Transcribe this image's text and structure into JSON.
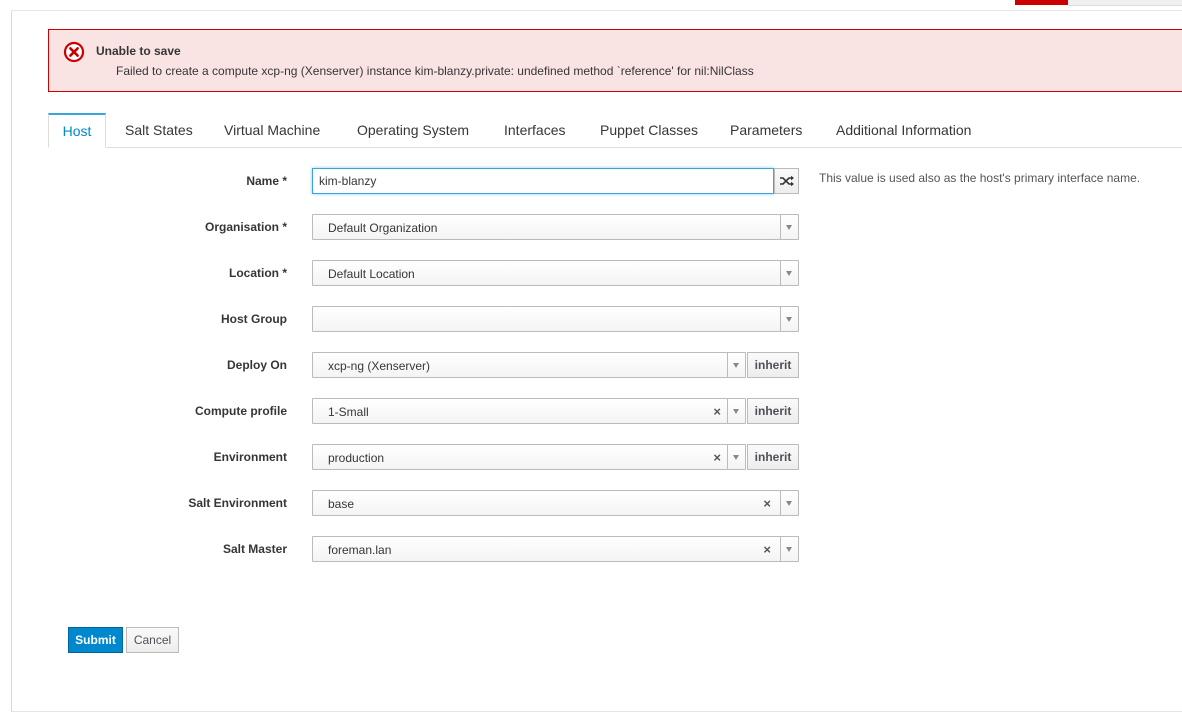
{
  "alert": {
    "title": "Unable to save",
    "message": "Failed to create a compute xcp-ng (Xenserver) instance kim-blanzy.private: undefined method `reference' for nil:NilClass"
  },
  "tabs": [
    {
      "label": "Host",
      "active": true
    },
    {
      "label": "Salt States"
    },
    {
      "label": "Virtual Machine"
    },
    {
      "label": "Operating System"
    },
    {
      "label": "Interfaces"
    },
    {
      "label": "Puppet Classes"
    },
    {
      "label": "Parameters"
    },
    {
      "label": "Additional Information"
    }
  ],
  "form": {
    "name": {
      "label": "Name *",
      "value": "kim-blanzy",
      "help": "This value is used also as the host's primary interface name."
    },
    "organisation": {
      "label": "Organisation *",
      "value": "Default Organization"
    },
    "location": {
      "label": "Location *",
      "value": "Default Location"
    },
    "host_group": {
      "label": "Host Group",
      "value": ""
    },
    "deploy_on": {
      "label": "Deploy On",
      "value": "xcp-ng (Xenserver)"
    },
    "compute_profile": {
      "label": "Compute profile",
      "value": "1-Small"
    },
    "environment": {
      "label": "Environment",
      "value": "production"
    },
    "salt_environment": {
      "label": "Salt Environment",
      "value": "base"
    },
    "salt_master": {
      "label": "Salt Master",
      "value": "foreman.lan"
    },
    "inherit_label": "inherit",
    "clear_symbol": "×"
  },
  "buttons": {
    "submit": "Submit",
    "cancel": "Cancel"
  },
  "colors": {
    "error": "#cc0000",
    "primary": "#0088ce",
    "active_tab": "#0088ce"
  }
}
